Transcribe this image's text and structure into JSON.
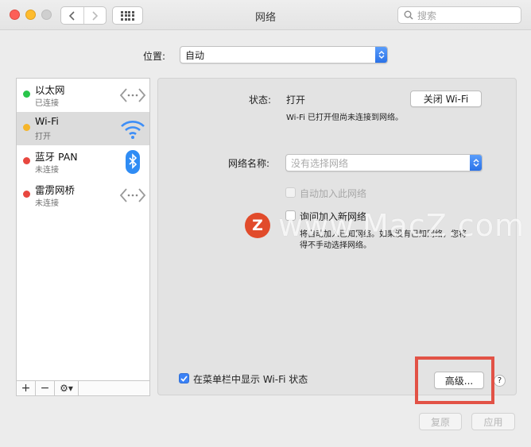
{
  "window": {
    "title": "网络",
    "search_placeholder": "搜索"
  },
  "location": {
    "label": "位置:",
    "value": "自动"
  },
  "services": [
    {
      "name": "以太网",
      "status": "已连接",
      "dot": "#29c54a",
      "icon": "ethernet-icon"
    },
    {
      "name": "Wi-Fi",
      "status": "打开",
      "dot": "#f5b52a",
      "icon": "wifi-icon"
    },
    {
      "name": "蓝牙 PAN",
      "status": "未连接",
      "dot": "#e8473f",
      "icon": "bluetooth-icon"
    },
    {
      "name": "雷雳网桥",
      "status": "未连接",
      "dot": "#e8473f",
      "icon": "thunderbolt-bridge-icon"
    }
  ],
  "sidebar_tools": {
    "add": "+",
    "remove": "−",
    "gear": "⚙▾"
  },
  "detail": {
    "status_label": "状态:",
    "status_value": "打开",
    "turn_off_button": "关闭 Wi-Fi",
    "status_desc": "Wi-Fi 已打开但尚未连接到网络。",
    "network_name_label": "网络名称:",
    "network_name_placeholder": "没有选择网络",
    "auto_join_label": "自动加入此网络",
    "ask_join_label": "询问加入新网络",
    "ask_join_desc_1": "将自动加入已知网络。如果没有已知网络，您将",
    "ask_join_desc_2": "得不手动选择网络。",
    "show_in_menubar_label": "在菜单栏中显示 Wi-Fi 状态",
    "advanced_button": "高级...",
    "help": "?"
  },
  "footer": {
    "revert": "复原",
    "apply": "应用"
  },
  "watermark": {
    "logo": "Z",
    "text": "www.MacZ.com"
  },
  "colors": {
    "accent": "#2a72e8",
    "highlight": "#e25246"
  }
}
